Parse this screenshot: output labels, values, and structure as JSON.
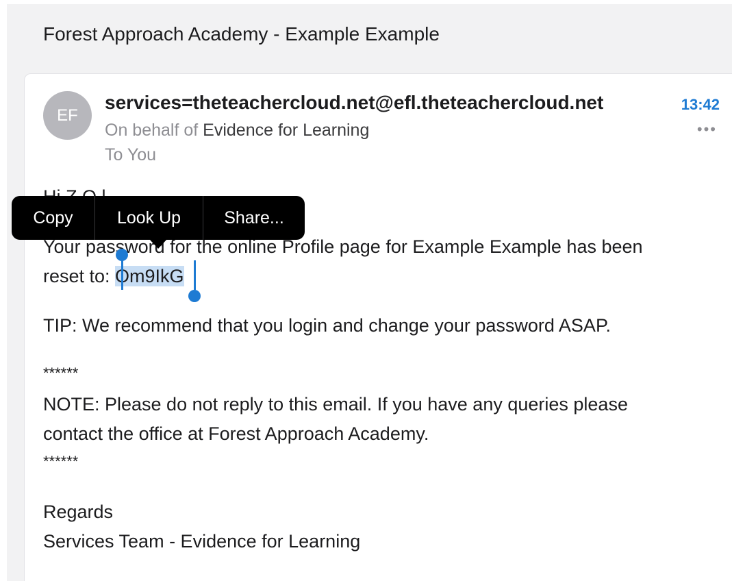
{
  "subject": "Forest Approach Academy - Example Example",
  "header": {
    "avatar_initials": "EF",
    "sender_email": "services=theteachercloud.net@efl.theteachercloud.net",
    "time": "13:42",
    "more_label": "•••",
    "on_behalf_prefix": "On behalf of ",
    "on_behalf_name": "Evidence for Learning",
    "recipient": "To You"
  },
  "context_menu": {
    "items": [
      "Copy",
      "Look Up",
      "Share..."
    ]
  },
  "body": {
    "greeting_partial": "Hi Z           O         l",
    "password_line_1": "Your password for the online Profile page for Example Example has been",
    "password_prefix": "reset to: ",
    "password_value": "Om9IkG",
    "tip": "TIP: We recommend that you login and change your password ASAP.",
    "separator_top": "******",
    "note_line_1": "NOTE: Please do not reply to this email. If you have any queries please",
    "note_line_2": "contact the office at Forest Approach Academy.",
    "separator_bottom": "******",
    "regards": "Regards",
    "signature": "Services Team - Evidence for Learning"
  },
  "colors": {
    "accent": "#1e7bd3",
    "selection": "#c7ddf4",
    "menu_background": "#000000",
    "secondary_text": "#8e8e93"
  }
}
